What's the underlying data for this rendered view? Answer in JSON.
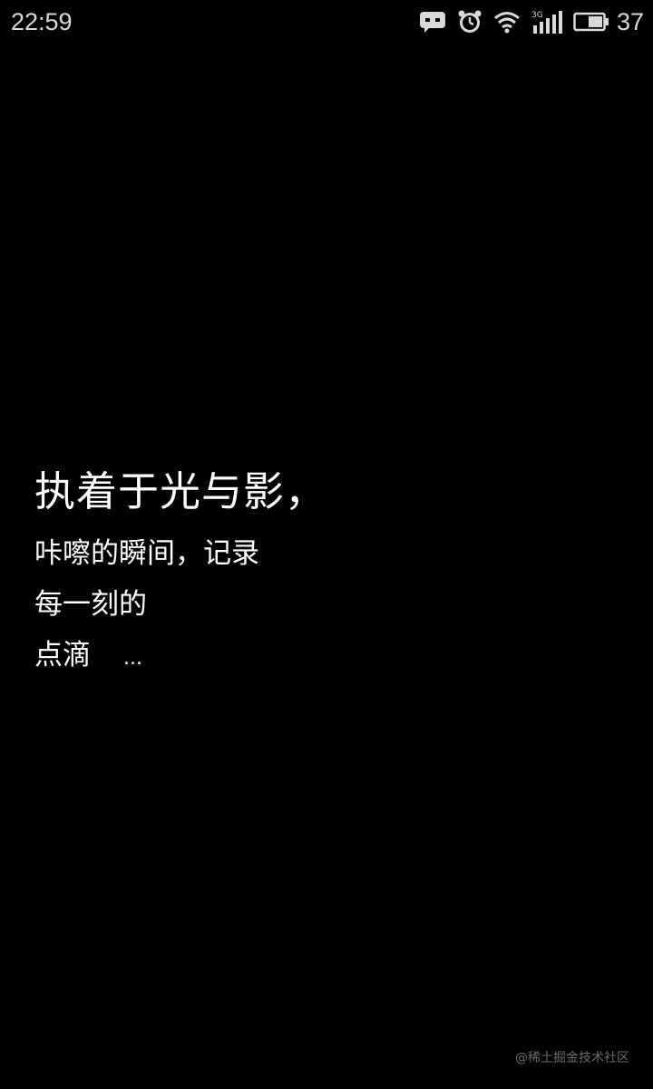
{
  "status_bar": {
    "time": "22:59",
    "battery_level": "37",
    "network_type": "3G",
    "icons": [
      "message-icon",
      "alarm-icon",
      "wifi-icon",
      "signal-icon",
      "battery-icon"
    ],
    "text_color": "#d9d9d9"
  },
  "content": {
    "headline": "执着于光与影，",
    "line_1": "咔嚓的瞬间，记录",
    "line_2": "每一刻的",
    "line_3": "点滴",
    "ellipsis": "..."
  },
  "watermark": "@稀土掘金技术社区",
  "colors": {
    "background": "#000000",
    "text": "#ffffff",
    "watermark": "#6b6b6b"
  }
}
